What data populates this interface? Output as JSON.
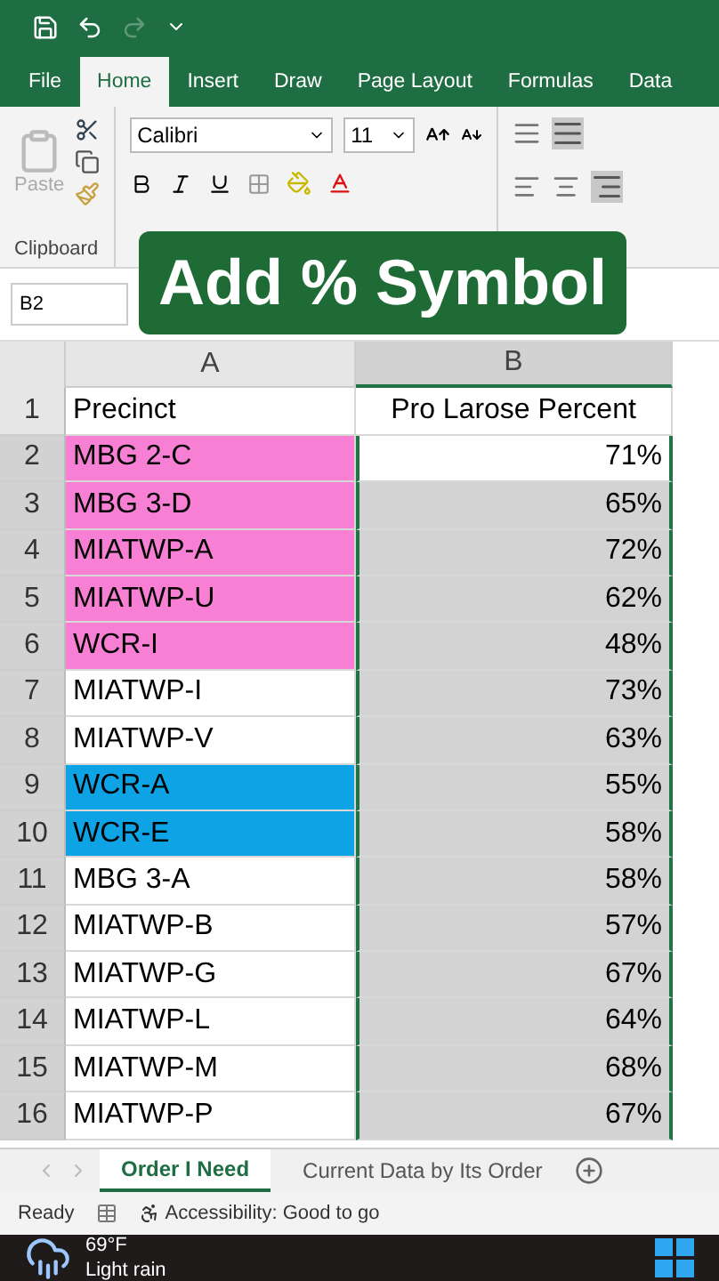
{
  "ribbon_tabs": [
    {
      "label": "File",
      "selected": false
    },
    {
      "label": "Home",
      "selected": true
    },
    {
      "label": "Insert",
      "selected": false
    },
    {
      "label": "Draw",
      "selected": false
    },
    {
      "label": "Page Layout",
      "selected": false
    },
    {
      "label": "Formulas",
      "selected": false
    },
    {
      "label": "Data",
      "selected": false
    }
  ],
  "clipboard": {
    "paste": "Paste",
    "group": "Clipboard"
  },
  "font": {
    "name": "Calibri",
    "size": "11"
  },
  "caption": "Add % Symbol",
  "name_box": "B2",
  "columns": [
    "A",
    "B"
  ],
  "rows": [
    {
      "num": "1",
      "a": "Precinct",
      "b": "Pro Larose Percent",
      "selected": false,
      "active": false
    },
    {
      "num": "2",
      "a": "MBG 2-C",
      "b": "71%",
      "color": "#f77fd4",
      "selected": true,
      "active": true
    },
    {
      "num": "3",
      "a": "MBG 3-D",
      "b": "65%",
      "color": "#f77fd4",
      "selected": true,
      "active": false
    },
    {
      "num": "4",
      "a": "MIATWP-A",
      "b": "72%",
      "color": "#f77fd4",
      "selected": true,
      "active": false
    },
    {
      "num": "5",
      "a": "MIATWP-U",
      "b": "62%",
      "color": "#f77fd4",
      "selected": true,
      "active": false
    },
    {
      "num": "6",
      "a": "WCR-I",
      "b": "48%",
      "color": "#f77fd4",
      "selected": true,
      "active": false
    },
    {
      "num": "7",
      "a": "MIATWP-I",
      "b": "73%",
      "selected": true,
      "active": false
    },
    {
      "num": "8",
      "a": "MIATWP-V",
      "b": "63%",
      "selected": true,
      "active": false
    },
    {
      "num": "9",
      "a": "WCR-A",
      "b": "55%",
      "color": "#0ea3e4",
      "selected": true,
      "active": false
    },
    {
      "num": "10",
      "a": "WCR-E",
      "b": "58%",
      "color": "#0ea3e4",
      "selected": true,
      "active": false
    },
    {
      "num": "11",
      "a": "MBG 3-A",
      "b": "58%",
      "selected": true,
      "active": false
    },
    {
      "num": "12",
      "a": "MIATWP-B",
      "b": "57%",
      "selected": true,
      "active": false
    },
    {
      "num": "13",
      "a": "MIATWP-G",
      "b": "67%",
      "selected": true,
      "active": false
    },
    {
      "num": "14",
      "a": "MIATWP-L",
      "b": "64%",
      "selected": true,
      "active": false
    },
    {
      "num": "15",
      "a": "MIATWP-M",
      "b": "68%",
      "selected": true,
      "active": false
    },
    {
      "num": "16",
      "a": "MIATWP-P",
      "b": "67%",
      "selected": true,
      "active": false
    }
  ],
  "sheet_tabs": [
    {
      "label": "Order I Need",
      "selected": true
    },
    {
      "label": "Current Data by Its Order",
      "selected": false
    }
  ],
  "status_bar": {
    "ready": "Ready",
    "accessibility": "Accessibility: Good to go"
  },
  "taskbar": {
    "temperature": "69°F",
    "weather": "Light rain"
  }
}
